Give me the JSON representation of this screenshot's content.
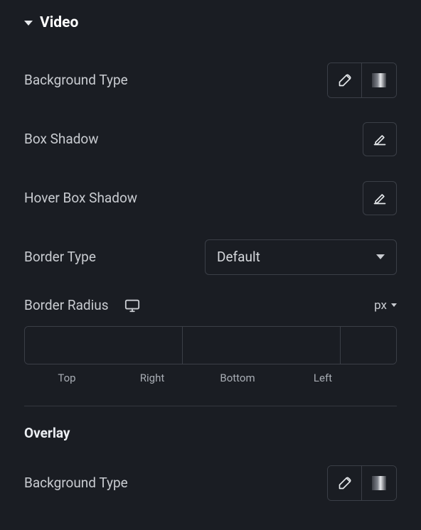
{
  "video": {
    "section_title": "Video",
    "background_type_label": "Background Type",
    "box_shadow_label": "Box Shadow",
    "hover_box_shadow_label": "Hover Box Shadow",
    "border_type_label": "Border Type",
    "border_type_value": "Default",
    "border_radius_label": "Border Radius",
    "border_radius_unit": "px",
    "radius": {
      "top": "",
      "right": "",
      "bottom": "",
      "left": "",
      "labels": {
        "top": "Top",
        "right": "Right",
        "bottom": "Bottom",
        "left": "Left"
      }
    }
  },
  "overlay": {
    "section_title": "Overlay",
    "background_type_label": "Background Type"
  }
}
